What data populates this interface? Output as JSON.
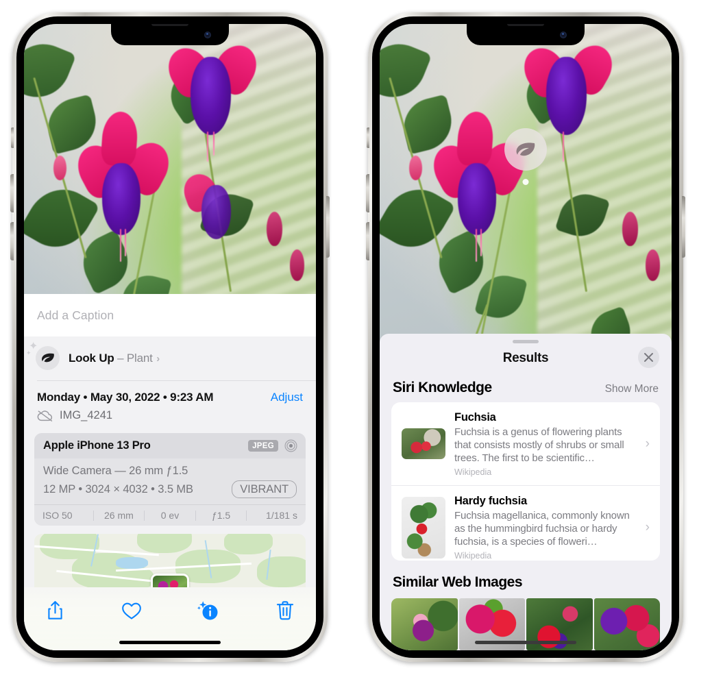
{
  "left_phone": {
    "caption_placeholder": "Add a Caption",
    "lookup": {
      "label": "Look Up",
      "dash": "–",
      "subject": "Plant",
      "chevron": "›",
      "icon": "leaf-icon"
    },
    "metadata": {
      "date_line": "Monday • May 30, 2022 • 9:23 AM",
      "adjust_label": "Adjust",
      "filename": "IMG_4241",
      "cloud_icon": "icloud-slash-icon"
    },
    "camera": {
      "device": "Apple iPhone 13 Pro",
      "format_badge": "JPEG",
      "aperture_icon": "aperture-icon",
      "lens_line": "Wide Camera — 26 mm ƒ1.5",
      "size_line": "12 MP • 3024 × 4032 • 3.5 MB",
      "style_badge": "VIBRANT",
      "exif": [
        "ISO 50",
        "26 mm",
        "0 ev",
        "ƒ1.5",
        "1/181 s"
      ]
    },
    "toolbar": [
      {
        "name": "share-button",
        "icon": "share-icon"
      },
      {
        "name": "favorite-button",
        "icon": "heart-icon"
      },
      {
        "name": "info-button",
        "icon": "info-sparkle-icon"
      },
      {
        "name": "delete-button",
        "icon": "trash-icon"
      }
    ],
    "accent_color": "#0a84ff"
  },
  "right_phone": {
    "lookup_badge": {
      "icon": "leaf-icon",
      "name": "visual-lookup-badge"
    },
    "sheet": {
      "title": "Results",
      "close_icon": "close-icon",
      "sections": [
        {
          "title": "Siri Knowledge",
          "action": "Show More",
          "cards": [
            {
              "title": "Fuchsia",
              "description": "Fuchsia is a genus of flowering plants that consists mostly of shrubs or small trees. The first to be scientific…",
              "source": "Wikipedia"
            },
            {
              "title": "Hardy fuchsia",
              "description": "Fuchsia magellanica, commonly known as the hummingbird fuchsia or hardy fuchsia, is a species of floweri…",
              "source": "Wikipedia"
            }
          ]
        },
        {
          "title": "Similar Web Images",
          "thumbnails": [
            "image-1",
            "image-2",
            "image-3",
            "image-4"
          ]
        }
      ]
    }
  }
}
